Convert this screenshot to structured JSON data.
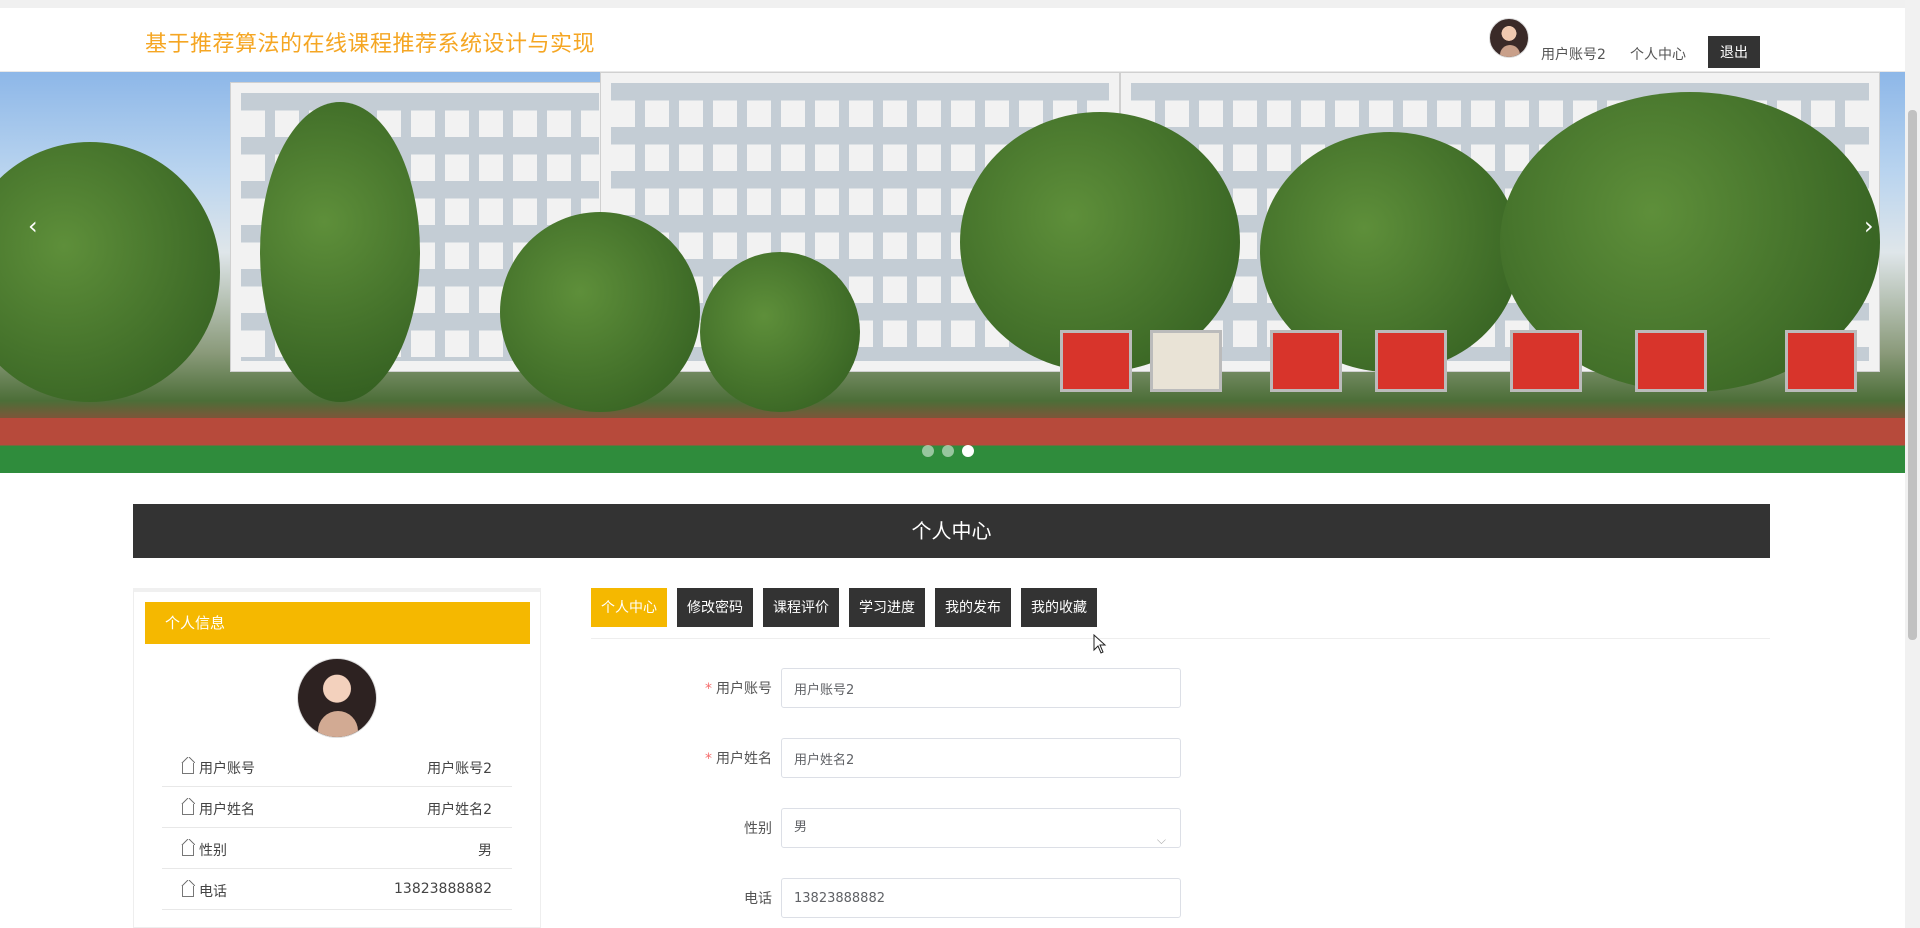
{
  "header": {
    "site_title": "基于推荐算法的在线课程推荐系统设计与实现",
    "username": "用户账号2",
    "personal_center": "个人中心",
    "logout": "退出"
  },
  "banner": {
    "prev_arrow": "‹",
    "next_arrow": "›",
    "slides_count": 3,
    "active_slide": 3
  },
  "section_title": "个人中心",
  "profile_panel": {
    "heading": "个人信息",
    "rows": [
      {
        "label": "用户账号",
        "value": "用户账号2"
      },
      {
        "label": "用户姓名",
        "value": "用户姓名2"
      },
      {
        "label": "性别",
        "value": "男"
      },
      {
        "label": "电话",
        "value": "13823888882"
      }
    ]
  },
  "tabs": [
    {
      "label": "个人中心",
      "active": true
    },
    {
      "label": "修改密码",
      "active": false
    },
    {
      "label": "课程评价",
      "active": false
    },
    {
      "label": "学习进度",
      "active": false
    },
    {
      "label": "我的发布",
      "active": false
    },
    {
      "label": "我的收藏",
      "active": false
    }
  ],
  "form": {
    "account": {
      "label": "用户账号",
      "value": "用户账号2",
      "required": true
    },
    "name": {
      "label": "用户姓名",
      "value": "用户姓名2",
      "required": true
    },
    "gender": {
      "label": "性别",
      "value": "男"
    },
    "phone": {
      "label": "电话",
      "value": "13823888882"
    }
  },
  "colors": {
    "accent": "#f5b800",
    "title": "#f5a623",
    "dark": "#333333"
  }
}
